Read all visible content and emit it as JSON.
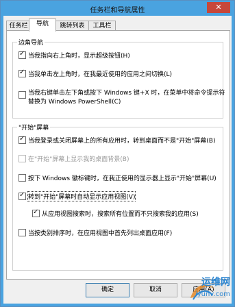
{
  "window": {
    "title": "任务栏和导航属性",
    "close_glyph": "✕"
  },
  "tabs": [
    {
      "label": "任务栏"
    },
    {
      "label": "导航"
    },
    {
      "label": "跳转列表"
    },
    {
      "label": "工具栏"
    }
  ],
  "corner_nav": {
    "title": "边角导航",
    "options": [
      {
        "label": "当我指向右上角时，显示超级按钮(H)",
        "checked": true
      },
      {
        "label": "当我单击左上角时，在我最近使用的应用之间切换(L)",
        "checked": true
      },
      {
        "label_line1": "当我右键单击左下角或按下 Windows 键+X 时，在菜单中将命令提示符",
        "label_line2": "替换为 Windows PowerShell(C)",
        "checked": false
      }
    ]
  },
  "start_screen": {
    "title": "\"开始\"屏幕",
    "options": [
      {
        "label": "当我登录或关闭屏幕上的所有应用时，转到桌面而不是\"开始\"屏幕(B)",
        "checked": true
      },
      {
        "label": "在\"开始\"屏幕上显示我的桌面背景(B)",
        "checked": false,
        "disabled": true
      },
      {
        "label": "按下 Windows 徽标键时，在我正使用的显示器上显示\"开始\"屏幕(U)",
        "checked": false
      },
      {
        "label": "转到\"开始\"屏幕时自动显示应用视图(V)",
        "checked": true
      },
      {
        "label": "从应用视图搜索时，搜索所有位置而不只搜索我的应用(S)",
        "checked": true
      },
      {
        "label": "当按类别排序时，在应用视图中首先列出桌面应用(F)",
        "checked": false
      }
    ]
  },
  "buttons": {
    "ok": "确定",
    "cancel": "取消",
    "apply": "应用(A)"
  },
  "watermark": {
    "line1": "运维网",
    "line2": "iyunv.com"
  },
  "colors": {
    "title_bar": "#4aa3e0",
    "close_button": "#c7473a",
    "default_button": "#3c7fb1"
  }
}
